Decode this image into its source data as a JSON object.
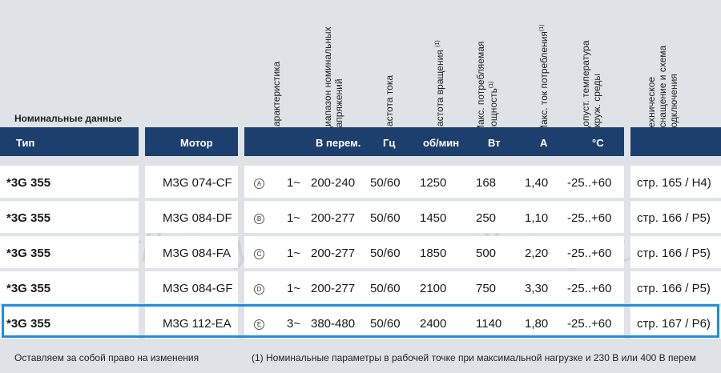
{
  "section_title": "Номинальные данные",
  "vertical_headers": [
    {
      "id": "char",
      "lines": [
        "Характеристика"
      ],
      "sup": ""
    },
    {
      "id": "vrange",
      "lines": [
        "Диапазон номинальных",
        "напряжений"
      ],
      "sup": ""
    },
    {
      "id": "freq",
      "lines": [
        "Частота тока"
      ],
      "sup": ""
    },
    {
      "id": "speed",
      "lines": [
        "Частота вращения"
      ],
      "sup": "(1)"
    },
    {
      "id": "power",
      "lines": [
        "Макс. потребляемая",
        "мощность"
      ],
      "sup": "(1)"
    },
    {
      "id": "current",
      "lines": [
        "Макс. ток потребления"
      ],
      "sup": "(1)"
    },
    {
      "id": "temp",
      "lines": [
        "Допуст. температура",
        "окруж. среды"
      ],
      "sup": ""
    },
    {
      "id": "tech",
      "lines": [
        "Техническое",
        "оснащение и схема",
        "подключения"
      ],
      "sup": ""
    }
  ],
  "header": {
    "type": "Тип",
    "motor": "Мотор",
    "voltage": "В перем.",
    "freq": "Гц",
    "speed": "об/мин",
    "power": "Вт",
    "current": "А",
    "temp": "°C"
  },
  "rows": [
    {
      "type": "*3G 355",
      "motor": "M3G 074-CF",
      "curve": "A",
      "phase": "1~",
      "voltage": "200-240",
      "freq": "50/60",
      "speed": "1250",
      "power": "168",
      "current": "1,40",
      "temp": "-25..+60",
      "ref": "стр. 165 / H4)"
    },
    {
      "type": "*3G 355",
      "motor": "M3G 084-DF",
      "curve": "B",
      "phase": "1~",
      "voltage": "200-277",
      "freq": "50/60",
      "speed": "1450",
      "power": "250",
      "current": "1,10",
      "temp": "-25..+60",
      "ref": "стр. 166 / P5)"
    },
    {
      "type": "*3G 355",
      "motor": "M3G 084-FA",
      "curve": "C",
      "phase": "1~",
      "voltage": "200-277",
      "freq": "50/60",
      "speed": "1850",
      "power": "500",
      "current": "2,20",
      "temp": "-25..+60",
      "ref": "стр. 166 / P5)"
    },
    {
      "type": "*3G 355",
      "motor": "M3G 084-GF",
      "curve": "D",
      "phase": "1~",
      "voltage": "200-277",
      "freq": "50/60",
      "speed": "2100",
      "power": "750",
      "current": "3,30",
      "temp": "-25..+60",
      "ref": "стр. 166 / P5)"
    },
    {
      "type": "*3G 355",
      "motor": "M3G 112-EA",
      "curve": "E",
      "phase": "3~",
      "voltage": "380-480",
      "freq": "50/60",
      "speed": "2400",
      "power": "1140",
      "current": "1,80",
      "temp": "-25..+60",
      "ref": "стр. 167 / P6)"
    }
  ],
  "watermark": "ventilatory.ru",
  "footer": {
    "left": "Оставляем за собой право на изменения",
    "right": "(1) Номинальные параметры в рабочей точке при максимальной нагрузке и 230 В или 400 В перем"
  },
  "colors": {
    "header_bg": "#1d3f6e",
    "page_bg": "#dfe3e8",
    "highlight": "#1e8fe0"
  }
}
